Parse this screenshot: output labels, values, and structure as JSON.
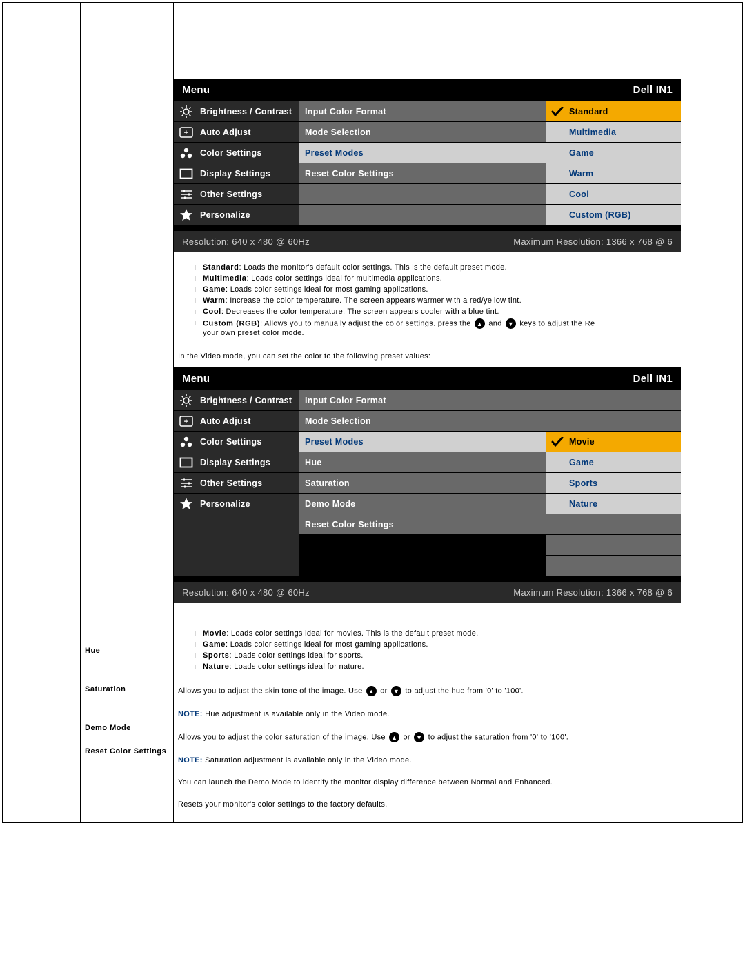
{
  "brand": "Dell IN1",
  "menuTitle": "Menu",
  "leftItems": [
    "Brightness / Contrast",
    "Auto Adjust",
    "Color Settings",
    "Display Settings",
    "Other Settings",
    "Personalize"
  ],
  "footer": {
    "res": "Resolution:  640 x 480 @ 60Hz",
    "max": "Maximum Resolution: 1366 x 768 @ 6"
  },
  "osd1": {
    "mid": [
      "Input Color Format",
      "Mode Selection",
      "Preset Modes",
      "Reset Color Settings",
      "",
      ""
    ],
    "midSel": 2,
    "right": [
      "Standard",
      "Multimedia",
      "Game",
      "Warm",
      "Cool",
      "Custom (RGB)"
    ],
    "rightSel": 0
  },
  "osd2": {
    "mid": [
      "Input Color Format",
      "Mode Selection",
      "Preset Modes",
      "Hue",
      "Saturation",
      "Demo Mode",
      "Reset Color Settings"
    ],
    "midSel": 2,
    "right": [
      "Movie",
      "Game",
      "Sports",
      "Nature",
      "",
      "",
      ""
    ],
    "rightSel": 0,
    "rightOffset": 2
  },
  "desc1": [
    {
      "b": "Standard",
      "t": ": Loads the monitor's default color settings. This is the default preset mode."
    },
    {
      "b": "Multimedia",
      "t": ": Loads color settings ideal for multimedia applications."
    },
    {
      "b": "Game",
      "t": ": Loads color settings ideal for most gaming applications."
    },
    {
      "b": "Warm",
      "t": ": Increase the color temperature. The screen appears warmer with a red/yellow tint."
    },
    {
      "b": "Cool",
      "t": ": Decreases the color temperature. The screen appears cooler with a blue tint."
    }
  ],
  "desc1custom": {
    "b": "Custom (RGB)",
    "t1": ": Allows you to manually adjust the color settings. press the ",
    "t2": " and ",
    "t3": " keys to adjust the Re",
    "t4": "your own preset color mode."
  },
  "midline": "In the Video mode, you can set the color to the following preset values:",
  "desc2": [
    {
      "b": "Movie",
      "t": ": Loads color settings ideal for movies. This is the default preset mode."
    },
    {
      "b": "Game",
      "t": ": Loads color settings ideal for most gaming applications."
    },
    {
      "b": "Sports",
      "t": ": Loads color settings ideal for sports."
    },
    {
      "b": "Nature",
      "t": ": Loads color settings ideal for nature."
    }
  ],
  "rows": {
    "hue": {
      "label": "Hue",
      "t1": "Allows you to adjust the skin tone of the image. Use ",
      "t2": " or ",
      "t3": " to adjust the hue from '0' to '100'.",
      "note": "NOTE:",
      "noteText": " Hue adjustment is available only in the Video mode."
    },
    "sat": {
      "label": "Saturation",
      "t1": "Allows you to adjust the color saturation of the image. Use ",
      "t2": " or ",
      "t3": " to adjust the saturation from '0' to '100'.",
      "note": "NOTE:",
      "noteText": " Saturation adjustment is available only in the Video mode."
    },
    "demo": {
      "label": "Demo Mode",
      "text": "You can launch the Demo Mode to identify the monitor display difference between Normal and Enhanced."
    },
    "reset": {
      "label": "Reset Color Settings",
      "text": "Resets your monitor's color settings to the factory defaults."
    }
  }
}
